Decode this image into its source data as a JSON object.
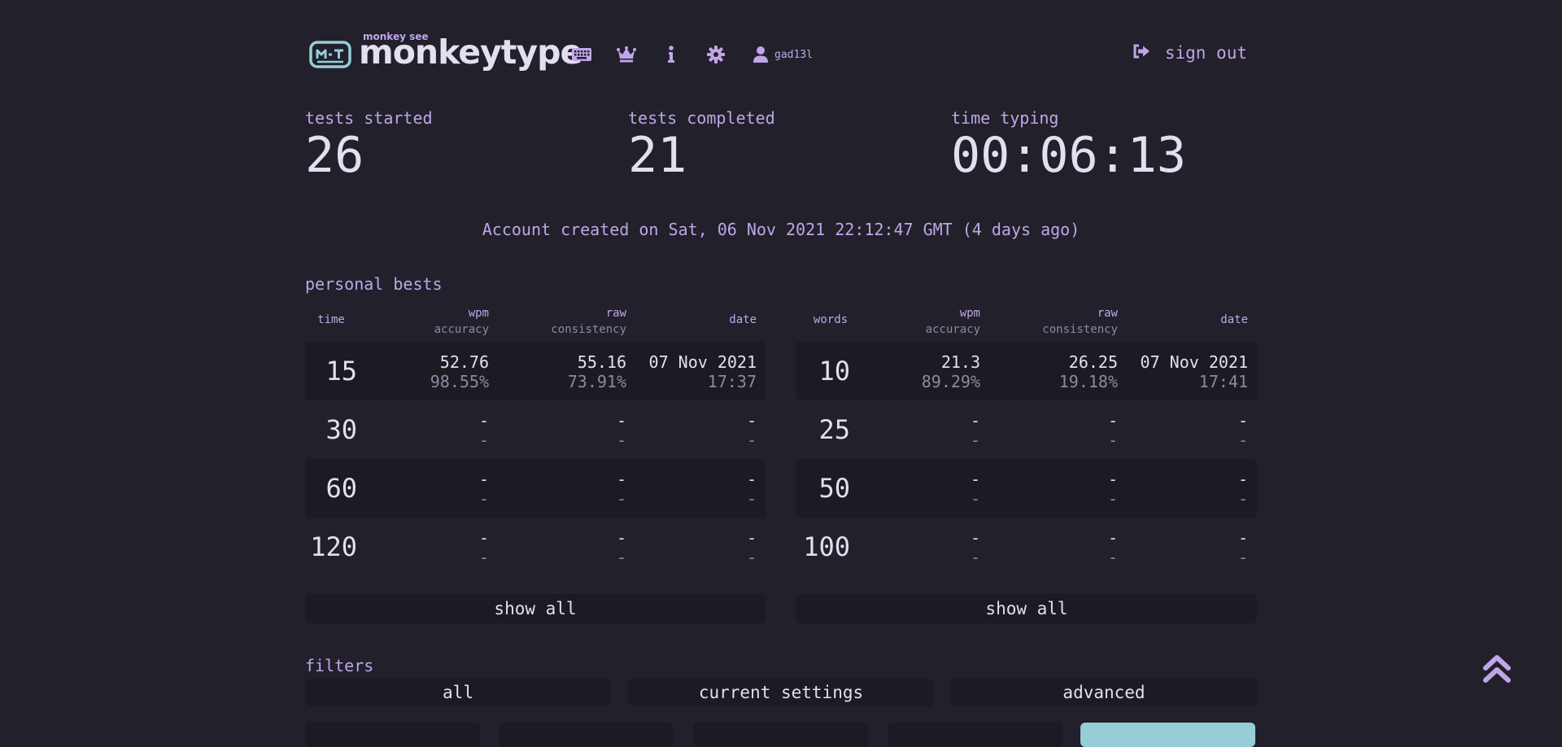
{
  "header": {
    "logo_sub": "monkey see",
    "logo_title": "monkeytype",
    "nav": [
      {
        "icon": "keyboard-icon"
      },
      {
        "icon": "crown-icon"
      },
      {
        "icon": "info-icon"
      },
      {
        "icon": "gear-icon"
      },
      {
        "icon": "user-icon"
      }
    ],
    "username": "gad13l",
    "sign_out": "sign out"
  },
  "stats": {
    "tests_started": {
      "label": "tests started",
      "value": "26"
    },
    "tests_completed": {
      "label": "tests completed",
      "value": "21"
    },
    "time_typing": {
      "label": "time typing",
      "value": "00:06:13"
    }
  },
  "account_created": "Account created on Sat, 06 Nov 2021 22:12:47 GMT (4 days ago)",
  "personal_bests": {
    "title": "personal bests",
    "time": {
      "headers": {
        "key": "time",
        "wpm": "wpm",
        "accuracy": "accuracy",
        "raw": "raw",
        "consistency": "consistency",
        "date": "date"
      },
      "rows": [
        {
          "key": "15",
          "wpm": "52.76",
          "accuracy": "98.55%",
          "raw": "55.16",
          "consistency": "73.91%",
          "date": "07 Nov 2021",
          "time": "17:37"
        },
        {
          "key": "30",
          "wpm": "-",
          "accuracy": "-",
          "raw": "-",
          "consistency": "-",
          "date": "-",
          "time": "-"
        },
        {
          "key": "60",
          "wpm": "-",
          "accuracy": "-",
          "raw": "-",
          "consistency": "-",
          "date": "-",
          "time": "-"
        },
        {
          "key": "120",
          "wpm": "-",
          "accuracy": "-",
          "raw": "-",
          "consistency": "-",
          "date": "-",
          "time": "-"
        }
      ],
      "show_all": "show all"
    },
    "words": {
      "headers": {
        "key": "words",
        "wpm": "wpm",
        "accuracy": "accuracy",
        "raw": "raw",
        "consistency": "consistency",
        "date": "date"
      },
      "rows": [
        {
          "key": "10",
          "wpm": "21.3",
          "accuracy": "89.29%",
          "raw": "26.25",
          "consistency": "19.18%",
          "date": "07 Nov 2021",
          "time": "17:41"
        },
        {
          "key": "25",
          "wpm": "-",
          "accuracy": "-",
          "raw": "-",
          "consistency": "-",
          "date": "-",
          "time": "-"
        },
        {
          "key": "50",
          "wpm": "-",
          "accuracy": "-",
          "raw": "-",
          "consistency": "-",
          "date": "-",
          "time": "-"
        },
        {
          "key": "100",
          "wpm": "-",
          "accuracy": "-",
          "raw": "-",
          "consistency": "-",
          "date": "-",
          "time": "-"
        }
      ],
      "show_all": "show all"
    }
  },
  "filters": {
    "title": "filters",
    "buttons": [
      "all",
      "current settings",
      "advanced"
    ]
  },
  "colors": {
    "background": "#21202b",
    "accent": "#c0a6e6",
    "text": "#e2e0ee",
    "sub": "#8c899e",
    "highlight": "#97cdd7"
  }
}
